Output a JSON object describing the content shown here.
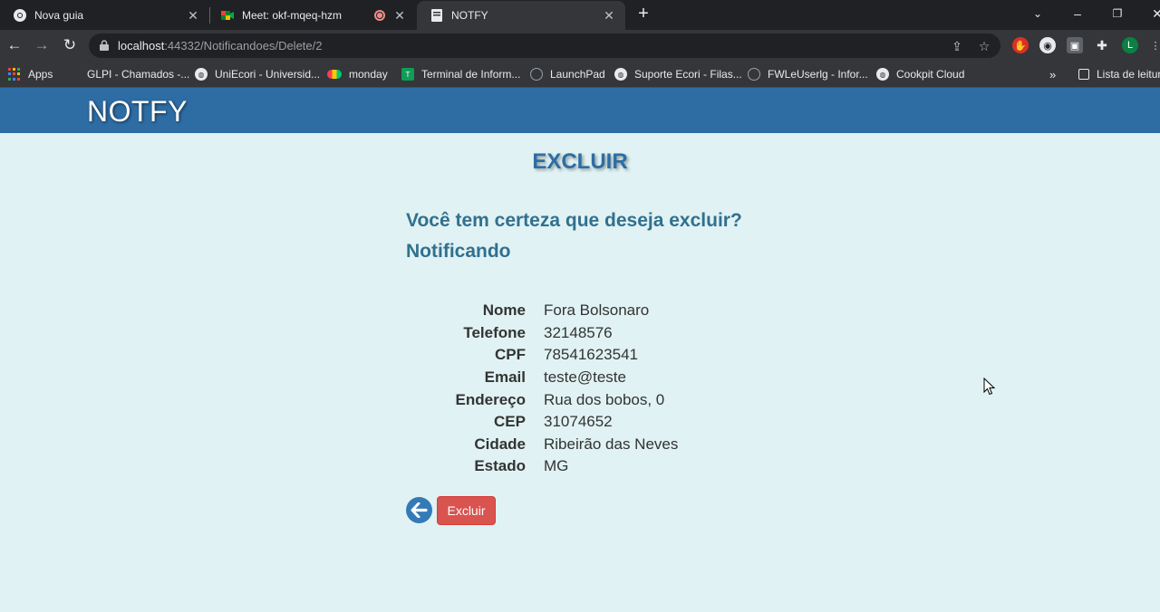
{
  "browser": {
    "tabs": [
      {
        "title": "Nova guia"
      },
      {
        "title": "Meet: okf-mqeq-hzm"
      },
      {
        "title": "NOTFY"
      }
    ],
    "url_host": "localhost",
    "url_path": ":44332/Notificandoes/Delete/2",
    "bookmarks": [
      "Apps",
      "GLPI - Chamados -...",
      "UniEcori - Universid...",
      "monday",
      "Terminal de Inform...",
      "LaunchPad",
      "Suporte Ecori - Filas...",
      "FWLeUserlg - Infor...",
      "Cookpit Cloud"
    ],
    "reading_list": "Lista de leitura",
    "profile_initial": "L"
  },
  "app": {
    "brand": "NOTFY"
  },
  "page": {
    "title": "EXCLUIR",
    "question": "Você tem certeza que deseja excluir?",
    "entity": "Notificando",
    "fields": [
      {
        "label": "Nome",
        "value": "Fora Bolsonaro"
      },
      {
        "label": "Telefone",
        "value": "32148576"
      },
      {
        "label": "CPF",
        "value": "78541623541"
      },
      {
        "label": "Email",
        "value": "teste@teste"
      },
      {
        "label": "Endereço",
        "value": "Rua dos bobos, 0"
      },
      {
        "label": "CEP",
        "value": "31074652"
      },
      {
        "label": "Cidade",
        "value": "Ribeirão das Neves"
      },
      {
        "label": "Estado",
        "value": "MG"
      }
    ],
    "delete_label": "Excluir"
  },
  "colors": {
    "navbar": "#2e6da4",
    "page_bg": "#e0f2f3",
    "danger": "#d9534f",
    "heading": "#31708f"
  }
}
